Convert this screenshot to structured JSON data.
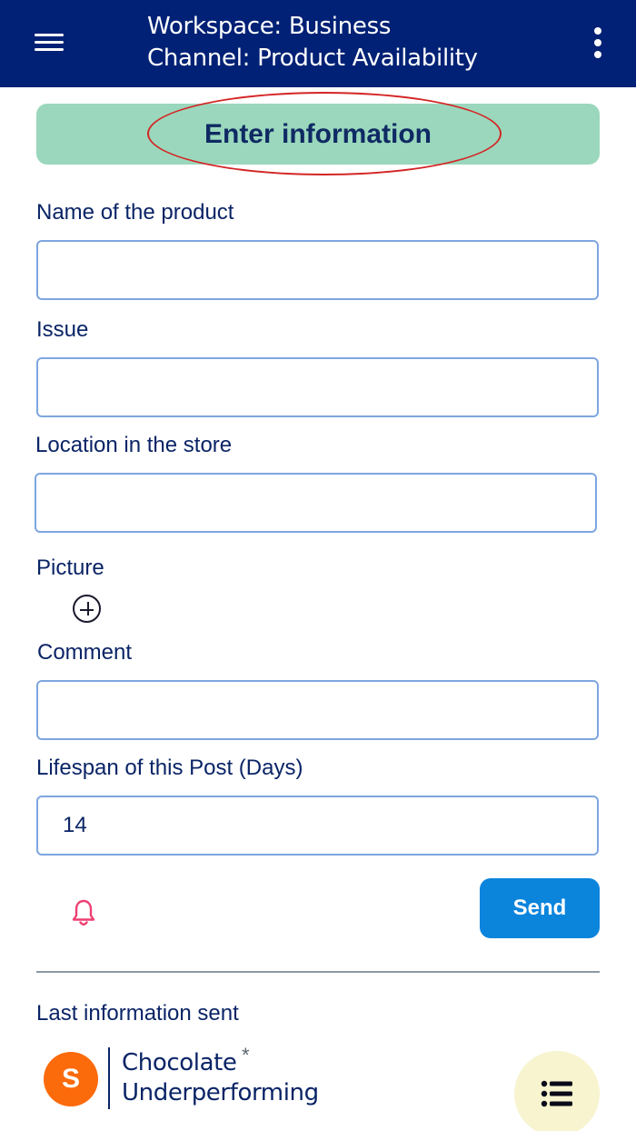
{
  "topbar": {
    "workspace": "Workspace: Business",
    "channel": "Channel: Product Availability"
  },
  "form": {
    "header": "Enter information",
    "fields": {
      "product_name": {
        "label": "Name of the product",
        "value": ""
      },
      "issue": {
        "label": "Issue",
        "value": ""
      },
      "location": {
        "label": "Location in the store",
        "value": ""
      },
      "picture": {
        "label": "Picture"
      },
      "comment": {
        "label": "Comment",
        "value": ""
      },
      "lifespan": {
        "label": "Lifespan of this Post (Days)",
        "value": "14"
      }
    },
    "send_label": "Send"
  },
  "last_sent": {
    "heading": "Last information sent",
    "avatar_initial": "S",
    "title": "Chocolate",
    "subtitle": "Underperforming",
    "marker": "*"
  },
  "icons": {
    "menu": "hamburger-icon",
    "more": "kebab-icon",
    "add_picture": "plus-circle-icon",
    "notify": "bell-icon",
    "list": "list-icon"
  },
  "colors": {
    "topbar": "#002175",
    "banner": "#9ad7bc",
    "highlight_ellipse": "#d42525",
    "send": "#0b84dc",
    "bell": "#ef3f72",
    "avatar": "#fb6a0b",
    "fab": "#f7f4cf"
  }
}
